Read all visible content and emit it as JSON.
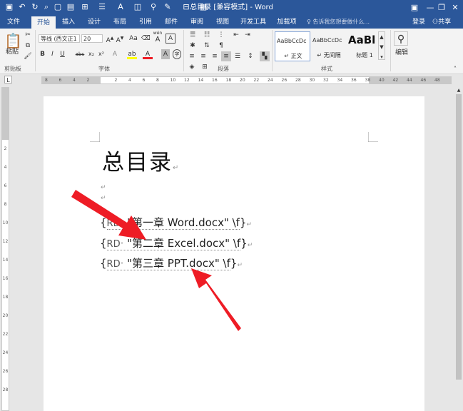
{
  "titlebar": {
    "title": "总目录 [兼容模式] - Word",
    "quick_access": [
      "save-icon",
      "undo-icon",
      "redo-icon",
      "print-preview-icon",
      "new-doc-icon",
      "paste-options-icon",
      "format-icon",
      "bullets-icon",
      "font-color-icon",
      "show-icon",
      "find-icon",
      "draw-icon",
      "layout-icon",
      "chart-icon"
    ]
  },
  "tabs": [
    "文件",
    "开始",
    "插入",
    "设计",
    "布局",
    "引用",
    "邮件",
    "审阅",
    "视图",
    "开发工具",
    "加载项"
  ],
  "active_tab": "开始",
  "tell_me": "告诉我您想要做什么...",
  "signin": "登录",
  "share": "共享",
  "ribbon": {
    "clipboard": {
      "paste": "粘贴",
      "label": "剪贴板"
    },
    "font": {
      "name": "等线 (西文正1",
      "size": "20",
      "label": "字体",
      "wen": "wén",
      "A": "A"
    },
    "paragraph": {
      "label": "段落"
    },
    "styles": {
      "label": "样式",
      "items": [
        {
          "sample": "AaBbCcDc",
          "name": "↵ 正文"
        },
        {
          "sample": "AaBbCcDc",
          "name": "↵ 无间隔"
        },
        {
          "sample": "AaBl",
          "name": "标题 1"
        }
      ]
    },
    "editing": {
      "label": "编辑"
    }
  },
  "ruler": {
    "numbers": [
      "8",
      "6",
      "4",
      "2",
      "",
      "2",
      "4",
      "6",
      "8",
      "10",
      "12",
      "14",
      "16",
      "18",
      "20",
      "22",
      "24",
      "26",
      "28",
      "30",
      "32",
      "34",
      "36",
      "38",
      "40",
      "42",
      "44",
      "46",
      "48"
    ]
  },
  "vruler": {
    "numbers": [
      "2",
      "4",
      "6",
      "8",
      "10",
      "12",
      "14",
      "16",
      "18",
      "20",
      "22",
      "24",
      "26",
      "28"
    ]
  },
  "document": {
    "title": "总目录",
    "para_marks": [
      "↵",
      "↵",
      "↵"
    ],
    "fields": [
      {
        "open": "{",
        "code": "RD",
        "sep": "·  ",
        "target": "\"第一章 Word.docx\"",
        "switch": " \\f",
        "close": "}",
        "mark": "↵"
      },
      {
        "open": "{",
        "code": "RD",
        "sep": "·  ",
        "target": "\"第二章 Excel.docx\"",
        "switch": " \\f",
        "close": "}",
        "mark": "↵"
      },
      {
        "open": "{",
        "code": "RD",
        "sep": "·  ",
        "target": "\"第三章 PPT.docx\"",
        "switch": " \\f",
        "close": "}",
        "mark": "↵"
      }
    ]
  },
  "colors": {
    "accent": "#2b579a",
    "arrow": "#ee1c25"
  }
}
